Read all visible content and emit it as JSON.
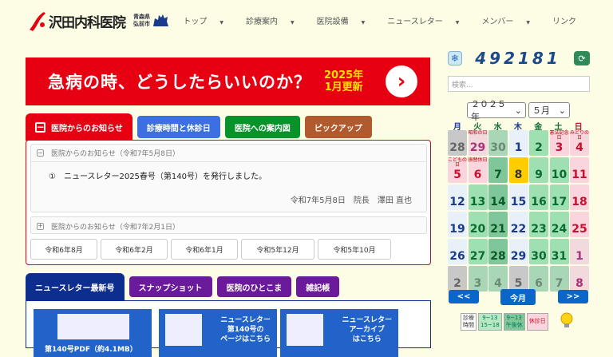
{
  "header": {
    "logo_name": "沢田内科医院",
    "logo_city_1": "青森県",
    "logo_city_2": "弘前市",
    "nav": [
      {
        "label": "トップ",
        "dropdown": true,
        "active": true
      },
      {
        "label": "診療案内",
        "dropdown": true
      },
      {
        "label": "医院設備",
        "dropdown": true
      },
      {
        "label": "ニュースレター",
        "dropdown": true
      },
      {
        "label": "メンバー",
        "dropdown": true
      },
      {
        "label": "リンク",
        "dropdown": false
      }
    ]
  },
  "banner": {
    "text": "急病の時、どうしたらいいのか？",
    "update_1": "2025年",
    "update_2": "1月更新",
    "arrow": "›"
  },
  "news_tabs": {
    "active": "医院からのお知らせ",
    "tab_hours": "診療時間と休診日",
    "tab_map": "医院への案内図",
    "tab_pickup": "ピックアップ"
  },
  "news": {
    "item1_head": "医院からのお知らせ（令和7年5月8日）",
    "item1_body": "①　ニュースレター2025春号（第140号）を発行しました。",
    "item1_sig": "令和7年5月8日　院長　澤田 直也",
    "item2_head": "医院からのお知らせ（令和7年2月1日）",
    "archive": [
      "令和6年8月",
      "令和6年2月",
      "令和6年1月",
      "令和5年12月",
      "令和5年10月"
    ]
  },
  "newsletter_tabs": {
    "active": "ニュースレター最新号",
    "tab_snap": "スナップショット",
    "tab_people": "医院のひとこま",
    "tab_misc": "雑記帳"
  },
  "newsletter_cards": {
    "card1": "第140号PDF（約4.1MB）",
    "card2_1": "ニュースレター",
    "card2_2": "第140号の",
    "card2_3": "ページはこちら",
    "card3_1": "ニュースレター",
    "card3_2": "アーカイブ",
    "card3_3": "はこちら"
  },
  "sidebar": {
    "counter": "492181",
    "search_placeholder": "検索...",
    "year_select": "２０２５年",
    "month_select": "５月",
    "weekdays": [
      "月",
      "火",
      "水",
      "木",
      "金",
      "土",
      "日"
    ],
    "prev": "<<",
    "today": "今月",
    "next": ">>",
    "legend_label_1": "診療",
    "legend_label_2": "時間",
    "legend_time_1": "9~13",
    "legend_time_2": "15~18",
    "legend_half_1": "9~13",
    "legend_half_2": "午後休",
    "legend_closed": "休診日"
  },
  "calendar": [
    {
      "d": "28",
      "c": "ot"
    },
    {
      "d": "29",
      "c": "otp",
      "n": "昭和の日"
    },
    {
      "d": "30",
      "c": "otg"
    },
    {
      "d": "1",
      "c": "w"
    },
    {
      "d": "2",
      "c": "gr"
    },
    {
      "d": "3",
      "c": "pk",
      "n": "憲法記念日"
    },
    {
      "d": "4",
      "c": "pk",
      "n": "みどりの日"
    },
    {
      "d": "5",
      "c": "pk",
      "n": "こどもの日"
    },
    {
      "d": "6",
      "c": "pk",
      "n": "振替休日"
    },
    {
      "d": "7",
      "c": "dg"
    },
    {
      "d": "8",
      "c": "today"
    },
    {
      "d": "9",
      "c": "gr"
    },
    {
      "d": "10",
      "c": "gr"
    },
    {
      "d": "11",
      "c": "pk"
    },
    {
      "d": "12",
      "c": "w"
    },
    {
      "d": "13",
      "c": "gr"
    },
    {
      "d": "14",
      "c": "dg"
    },
    {
      "d": "15",
      "c": "w"
    },
    {
      "d": "16",
      "c": "gr"
    },
    {
      "d": "17",
      "c": "gr"
    },
    {
      "d": "18",
      "c": "pk"
    },
    {
      "d": "19",
      "c": "w"
    },
    {
      "d": "20",
      "c": "gr"
    },
    {
      "d": "21",
      "c": "dg"
    },
    {
      "d": "22",
      "c": "w"
    },
    {
      "d": "23",
      "c": "gr"
    },
    {
      "d": "24",
      "c": "gr"
    },
    {
      "d": "25",
      "c": "pk"
    },
    {
      "d": "26",
      "c": "w"
    },
    {
      "d": "27",
      "c": "gr"
    },
    {
      "d": "28",
      "c": "dg"
    },
    {
      "d": "29",
      "c": "w"
    },
    {
      "d": "30",
      "c": "gr"
    },
    {
      "d": "31",
      "c": "gr"
    },
    {
      "d": "1",
      "c": "otp"
    },
    {
      "d": "2",
      "c": "ot"
    },
    {
      "d": "3",
      "c": "otg"
    },
    {
      "d": "4",
      "c": "otg"
    },
    {
      "d": "5",
      "c": "ot"
    },
    {
      "d": "6",
      "c": "otg"
    },
    {
      "d": "7",
      "c": "otg"
    },
    {
      "d": "8",
      "c": "otp"
    }
  ],
  "colors": {
    "red": "#e60012",
    "navy": "#0d2d8f",
    "accent": "#4a9bd6"
  }
}
